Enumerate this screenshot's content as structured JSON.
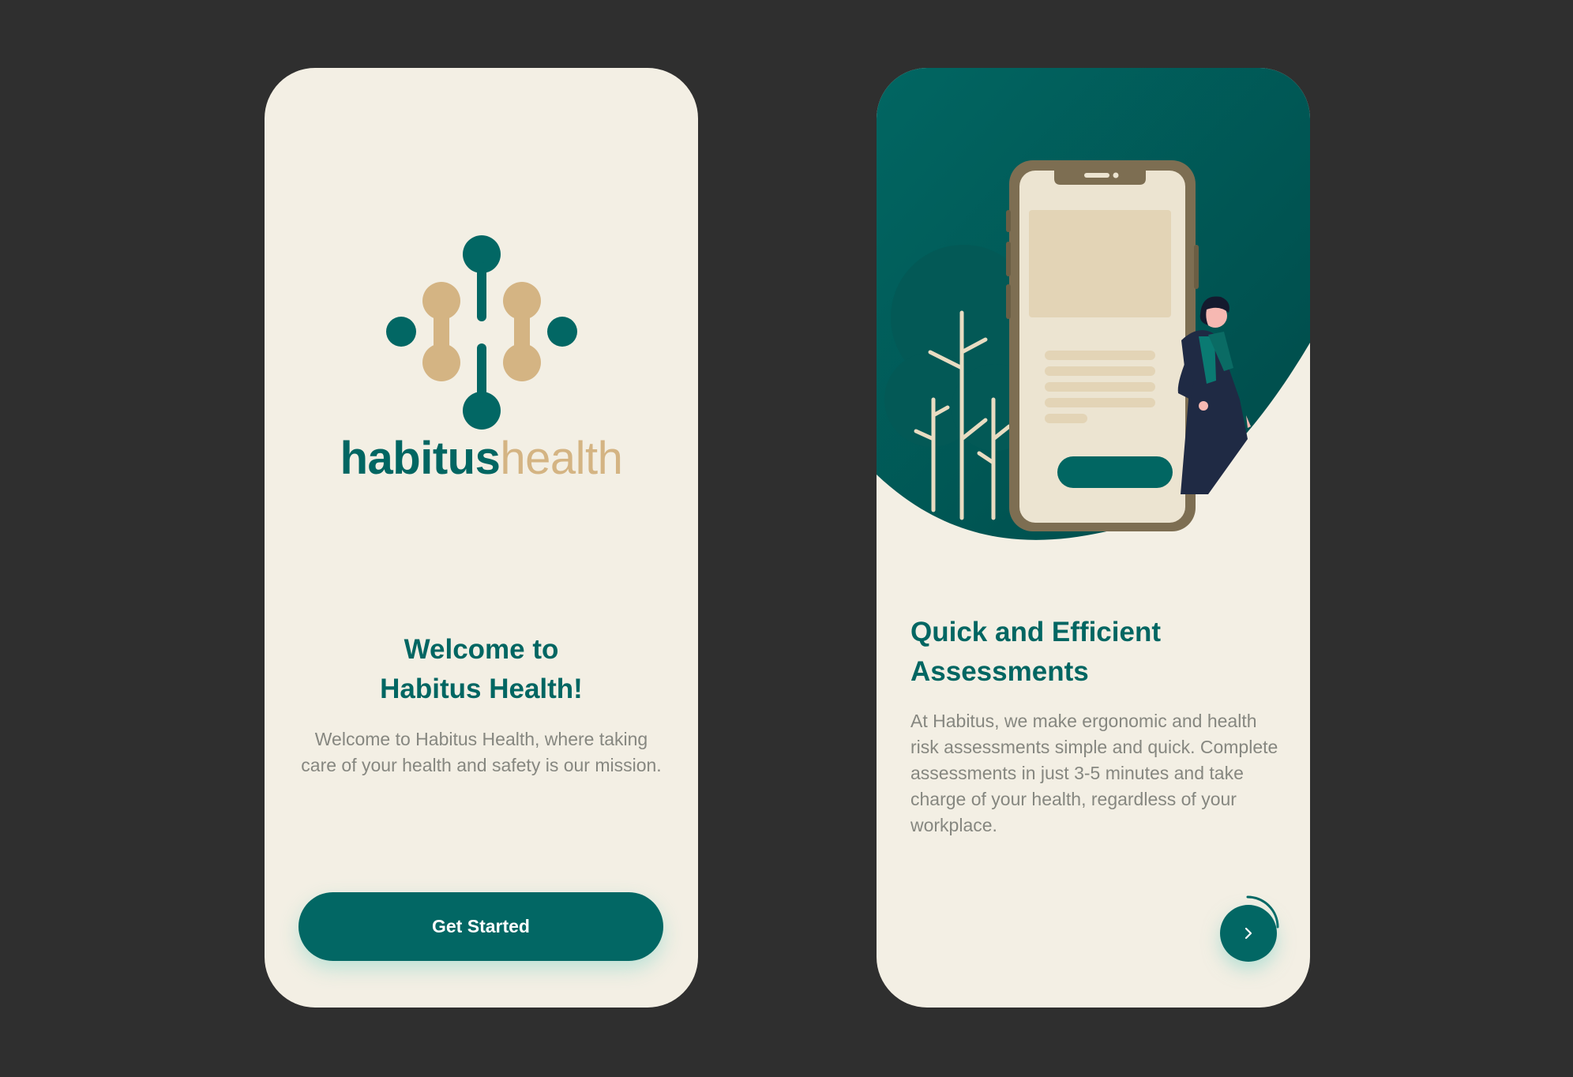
{
  "colors": {
    "background": "#2f2f2f",
    "card": "#f3efe4",
    "brand_teal": "#026764",
    "brand_sand": "#d4b483",
    "body_text": "#868780"
  },
  "welcome_screen": {
    "logo": {
      "word_primary": "habitus",
      "word_secondary": "health"
    },
    "title": "Welcome to\nHabitus Health!",
    "description": "Welcome to Habitus Health, where taking care of your health and safety is our mission.",
    "cta_label": "Get Started"
  },
  "assessment_screen": {
    "title": "Quick and Efficient\nAssessments",
    "description": "At Habitus, we make ergonomic and health risk assessments simple and quick. Complete assessments in just 3-5 minutes and take charge of your health, regardless of your workplace.",
    "next_icon": "chevron-right-icon",
    "progress_fraction": 0.25
  }
}
